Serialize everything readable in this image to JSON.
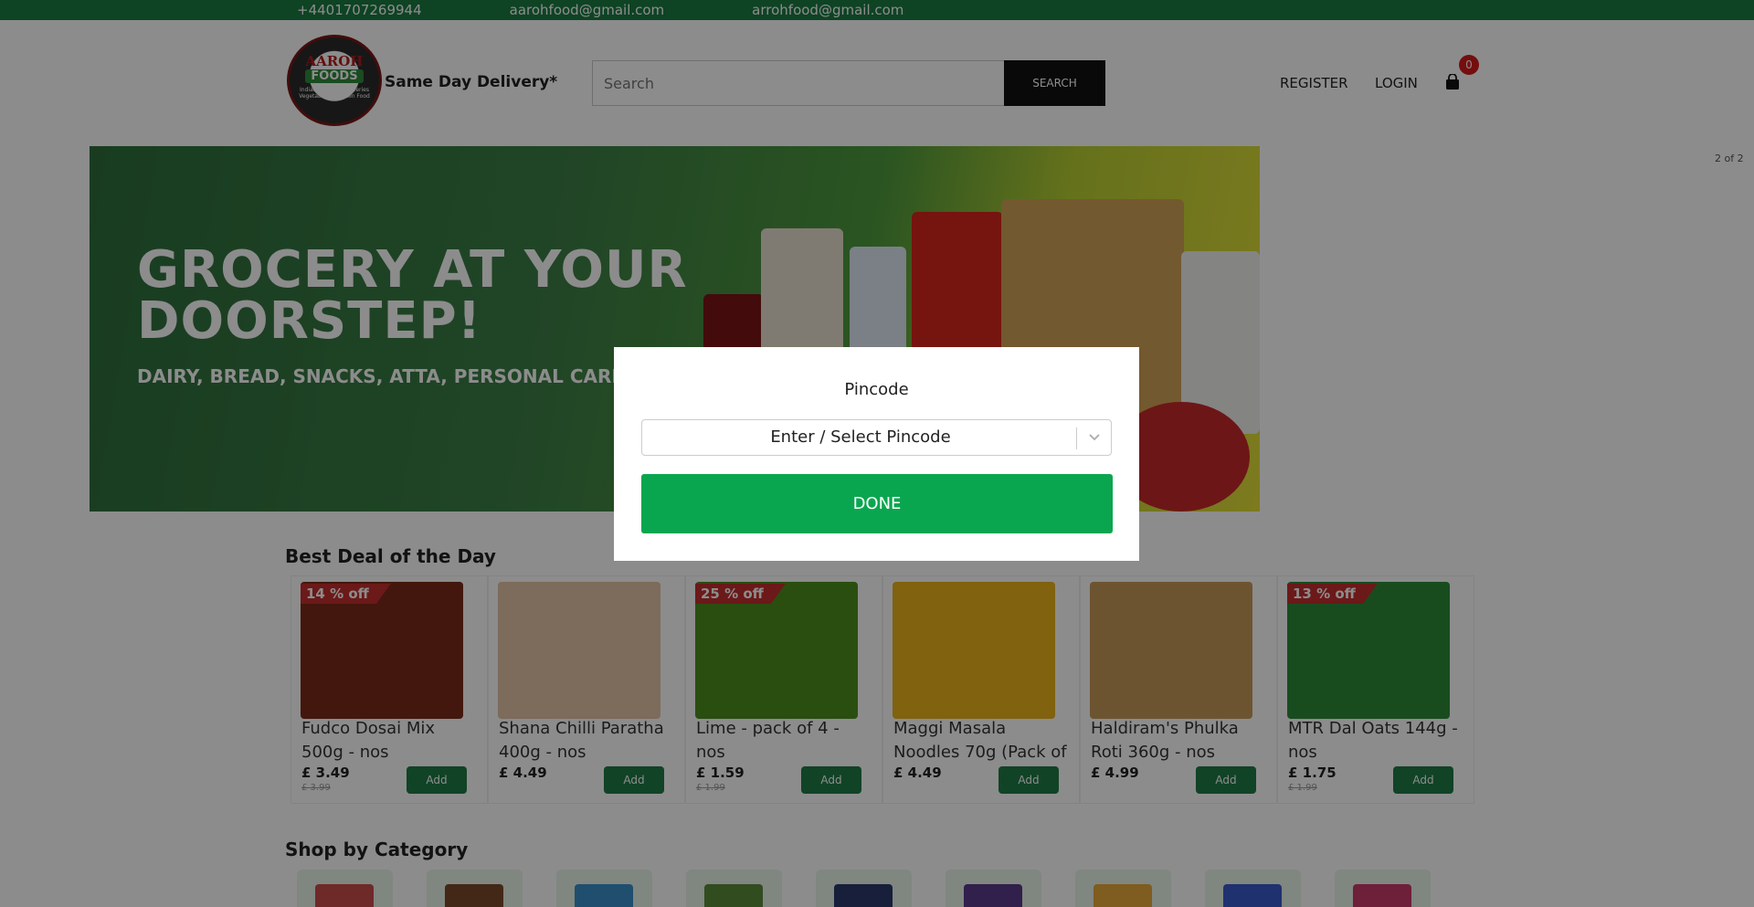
{
  "topbar": {
    "phone": "+4401707269944",
    "email1": "aarohfood@gmail.com",
    "email2": "arrohfood@gmail.com"
  },
  "header": {
    "logo": {
      "line1": "AAROH",
      "line2": "FOODS",
      "tagline": "Indian - African Groceries Vegetables & Frozen Food"
    },
    "delivery": "Same Day Delivery*",
    "search_placeholder": "Search",
    "search_button": "SEARCH",
    "register": "REGISTER",
    "login": "LOGIN",
    "cart_count": "0"
  },
  "banner": {
    "title": "GROCERY AT YOUR DOORSTEP!",
    "subtitle": "DAIRY, BREAD, SNACKS, ATTA, PERSONAL CARE AND MO",
    "counter": "2 of 2"
  },
  "best_deal": {
    "title": "Best Deal of the Day",
    "add_label": "Add",
    "products": [
      {
        "name": "Fudco Dosai Mix 500g - nos",
        "price": "£ 3.49",
        "old_price": "£ 3.99",
        "badge": "14 % off",
        "color": "#7a2a1a"
      },
      {
        "name": "Shana Chilli Paratha 400g - nos",
        "price": "£ 4.49",
        "old_price": "",
        "badge": "",
        "color": "#e3c3a6"
      },
      {
        "name": "Lime - pack of 4 - nos",
        "price": "£ 1.59",
        "old_price": "£ 1.99",
        "badge": "25 % off",
        "color": "#4e8f1e"
      },
      {
        "name": "Maggi Masala Noodles 70g (Pack of",
        "price": "£ 4.49",
        "old_price": "",
        "badge": "",
        "color": "#e9b31c"
      },
      {
        "name": "Haldiram's Phulka Roti 360g - nos",
        "price": "£ 4.99",
        "old_price": "",
        "badge": "",
        "color": "#c79a5a"
      },
      {
        "name": "MTR Dal Oats 144g - nos",
        "price": "£ 1.75",
        "old_price": "£ 1.99",
        "badge": "13 % off",
        "color": "#2c8a3a"
      }
    ]
  },
  "category": {
    "title": "Shop by Category",
    "thumb_colors": [
      "#c94b4b",
      "#7a4a2a",
      "#3a8fc9",
      "#5a8a3a",
      "#2a3a6a",
      "#5a3a8a",
      "#e8a83a",
      "#3a5ac9",
      "#c93a6a"
    ]
  },
  "modal": {
    "title": "Pincode",
    "select_placeholder": "Enter / Select Pincode",
    "done": "DONE"
  },
  "colors": {
    "brand_green": "#1a7a43",
    "done_green": "#0aa64f",
    "badge_red": "#c42e2e"
  }
}
